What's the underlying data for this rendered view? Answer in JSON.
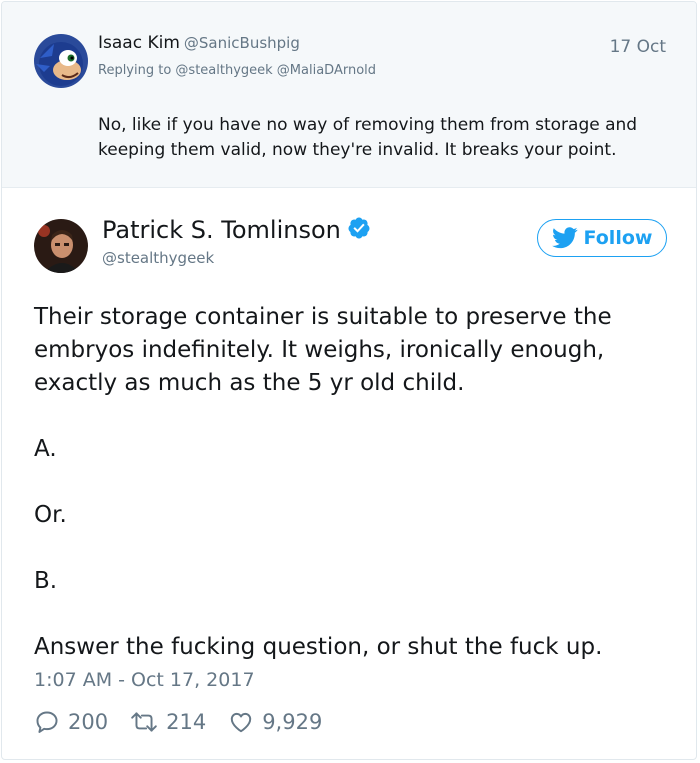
{
  "reply_tweet": {
    "author_name": "Isaac Kim",
    "author_handle": "@SanicBushpig",
    "date": "17 Oct",
    "replying_to": "Replying to @stealthygeek @MaliaDArnold",
    "text": "No, like if you have no way of removing them from storage and keeping them valid, now they're invalid. It breaks your point."
  },
  "main_tweet": {
    "author_name": "Patrick S. Tomlinson",
    "author_handle": "@stealthygeek",
    "verified_icon": "verified-badge-icon",
    "follow_label": "Follow",
    "paragraphs": [
      "Their storage container is suitable to preserve the embryos indefinitely. It weighs, ironically enough, exactly as much as the 5 yr old child.",
      "A.",
      "Or.",
      "B.",
      "Answer the fucking question, or shut the fuck up."
    ],
    "timestamp": "1:07 AM - Oct 17, 2017",
    "stats": {
      "replies": "200",
      "retweets": "214",
      "likes": "9,929"
    }
  },
  "colors": {
    "brand_blue": "#1da1f2",
    "secondary_text": "#657786",
    "reply_background": "#f5f8fa"
  }
}
